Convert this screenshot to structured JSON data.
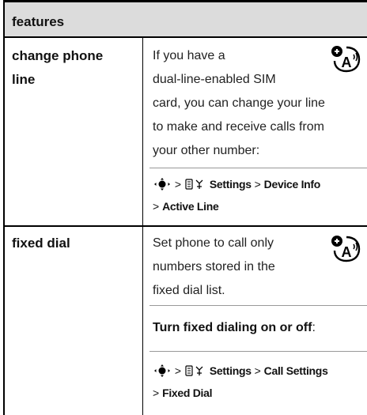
{
  "table": {
    "header": "features",
    "rows": [
      {
        "feature": [
          "change phone",
          "line"
        ],
        "description_lines": [
          "If you have a",
          "dual-line-enabled SIM",
          "card, you can change your line",
          "to make and receive calls from",
          "your other number:"
        ],
        "path": {
          "gt": ">",
          "menu": "Settings",
          "item": "Device Info",
          "item2": "Active Line"
        }
      },
      {
        "feature": [
          "fixed dial"
        ],
        "description_lines": [
          "Set phone to call only",
          "numbers stored in the",
          "fixed dial list."
        ],
        "emphasis": "Turn fixed dialing on or off",
        "emphasis_suffix": ":",
        "path": {
          "gt": ">",
          "menu": "Settings",
          "item": "Call Settings",
          "item2": "Fixed Dial"
        }
      }
    ]
  },
  "icons": [
    "network-dependent-feature-icon",
    "nav-key-icon",
    "settings-icon"
  ]
}
